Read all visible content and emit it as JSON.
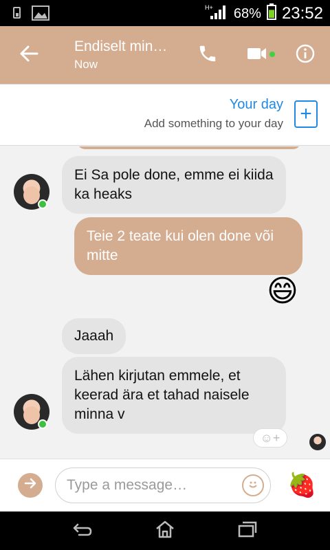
{
  "status_bar": {
    "network": "H+",
    "battery_percent": "68%",
    "battery_level": 0.68,
    "time": "23:52",
    "icons": [
      "sim-icon",
      "image-icon",
      "signal-icon",
      "battery-icon"
    ]
  },
  "header": {
    "title": "Endiselt min…",
    "subtitle": "Now",
    "icons": [
      "back-arrow-icon",
      "phone-icon",
      "video-camera-icon",
      "info-icon"
    ],
    "accent_color": "#d4ad91",
    "online_color": "#3fd23f"
  },
  "your_day": {
    "title": "Your day",
    "subtitle": "Add something to your day",
    "add_symbol": "+",
    "color": "#1e88e5"
  },
  "messages": [
    {
      "direction": "in",
      "text": "Ei Sa pole done, emme ei kiida ka heaks"
    },
    {
      "direction": "out",
      "text": "Teie 2 teate kui olen done või mitte"
    },
    {
      "direction": "out",
      "emoji": "😄"
    },
    {
      "direction": "in",
      "text": "Jaaah"
    },
    {
      "direction": "in",
      "text": "Lähen kirjutan  emmele, et keerad ära et tahad naisele minna v"
    }
  ],
  "composer": {
    "placeholder": "Type a message…",
    "strawberry": "🍓",
    "icons": [
      "expand-arrow-icon",
      "emoji-icon",
      "strawberry-icon"
    ]
  },
  "nav_bar": {
    "icons": [
      "back-icon",
      "home-icon",
      "recent-apps-icon"
    ]
  }
}
